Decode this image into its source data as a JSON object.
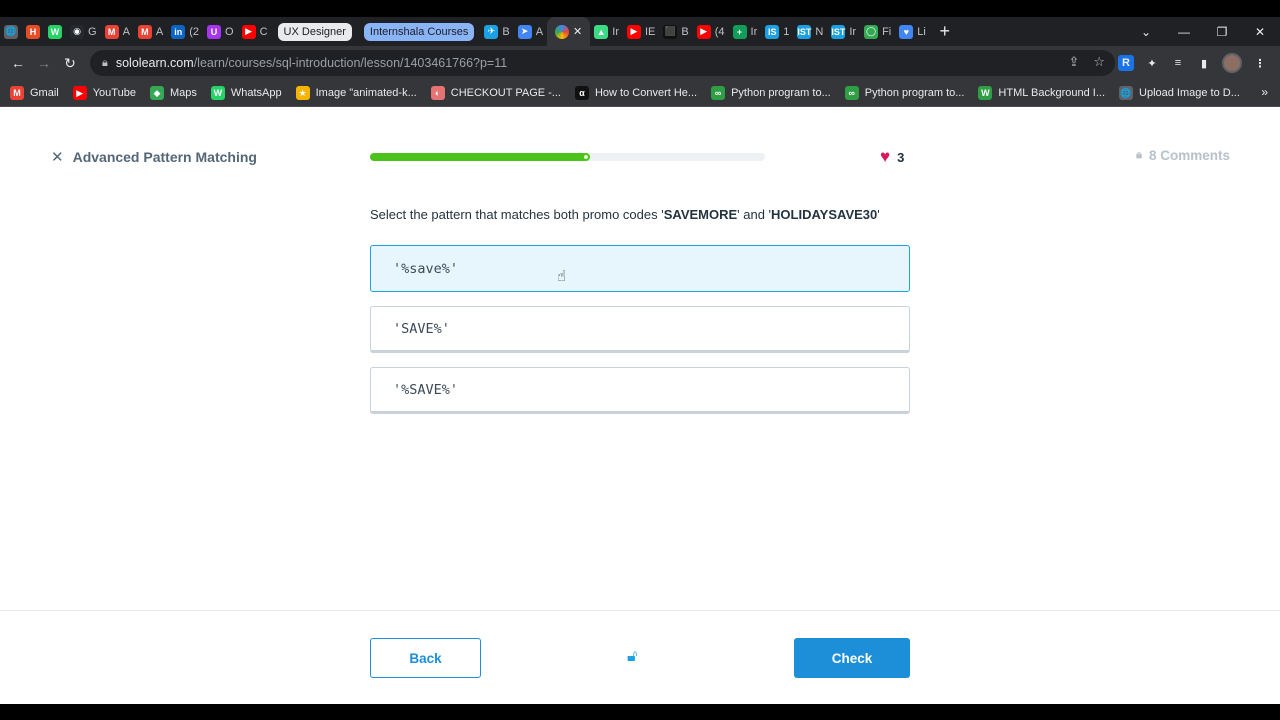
{
  "browser": {
    "tabs": [
      {
        "title": "",
        "fav": "🌐",
        "color": "#5f6368"
      },
      {
        "title": "",
        "fav": "H",
        "color": "#e44d26"
      },
      {
        "title": "",
        "fav": "W",
        "color": "#25d366"
      },
      {
        "title": "G",
        "fav": "◉",
        "color": "#24292e"
      },
      {
        "title": "A",
        "fav": "M",
        "color": "#ea4335"
      },
      {
        "title": "A",
        "fav": "M",
        "color": "#ea4335"
      },
      {
        "title": "(2",
        "fav": "in",
        "color": "#0a66c2"
      },
      {
        "title": "O",
        "fav": "U",
        "color": "#a435f0"
      },
      {
        "title": "C",
        "fav": "▶",
        "color": "#ff0000"
      }
    ],
    "group_ux": "UX Designer",
    "group_intern": "Internshala Courses",
    "tabs_after": [
      {
        "title": "B",
        "fav": "✈",
        "color": "#1da1e5"
      },
      {
        "title": "A",
        "fav": "➤",
        "color": "#4285f4"
      }
    ],
    "tabs_tail": [
      {
        "title": "Ir",
        "fav": "▲",
        "color": "#3ddc84"
      },
      {
        "title": "IE",
        "fav": "▶",
        "color": "#ff0000"
      },
      {
        "title": "B",
        "fav": "⬛",
        "color": "#111111"
      },
      {
        "title": "(4",
        "fav": "▶",
        "color": "#ff0000"
      },
      {
        "title": "Ir",
        "fav": "+",
        "color": "#0f9d58"
      },
      {
        "title": "1",
        "fav": "IS",
        "color": "#1ba1e2"
      },
      {
        "title": "N",
        "fav": "IST",
        "color": "#1ba1e2"
      },
      {
        "title": "Ir",
        "fav": "IST",
        "color": "#1ba1e2"
      },
      {
        "title": "Fi",
        "fav": "◯",
        "color": "#34a853"
      },
      {
        "title": "Li",
        "fav": "♥",
        "color": "#4285f4"
      }
    ],
    "url_host": "sololearn.com",
    "url_path": "/learn/courses/sql-introduction/lesson/1403461766?p=11",
    "bookmarks": [
      {
        "label": "Gmail",
        "fav": "M",
        "color": "#ea4335"
      },
      {
        "label": "YouTube",
        "fav": "▶",
        "color": "#ff0000"
      },
      {
        "label": "Maps",
        "fav": "◆",
        "color": "#34a853"
      },
      {
        "label": "WhatsApp",
        "fav": "W",
        "color": "#25d366"
      },
      {
        "label": "Image \"animated-k...",
        "fav": "★",
        "color": "#f4b400"
      },
      {
        "label": "CHECKOUT PAGE -...",
        "fav": "◐",
        "color": "#e57373"
      },
      {
        "label": "How to Convert He...",
        "fav": "α",
        "color": "#111111"
      },
      {
        "label": "Python program to...",
        "fav": "∞",
        "color": "#2f9e44"
      },
      {
        "label": "Python program to...",
        "fav": "∞",
        "color": "#2f9e44"
      },
      {
        "label": "HTML Background I...",
        "fav": "W",
        "color": "#2f9e44"
      },
      {
        "label": "Upload Image to D...",
        "fav": "🌐",
        "color": "#5f6368"
      }
    ]
  },
  "lesson": {
    "title": "Advanced Pattern Matching",
    "progress": 0.55,
    "hearts": "3",
    "comments": "8 Comments",
    "question_prefix": "Select the pattern that matches both promo codes '",
    "code1": "SAVEMORE",
    "question_mid": "' and '",
    "code2": "HOLIDAYSAVE30",
    "question_suffix": "'",
    "options": [
      "'%save%'",
      "'SAVE%'",
      "'%SAVE%'"
    ],
    "selected_index": 0,
    "back_label": "Back",
    "check_label": "Check"
  },
  "colors": {
    "accent": "#1d8fd8",
    "progress": "#4cc31b",
    "heart": "#d8185c"
  }
}
